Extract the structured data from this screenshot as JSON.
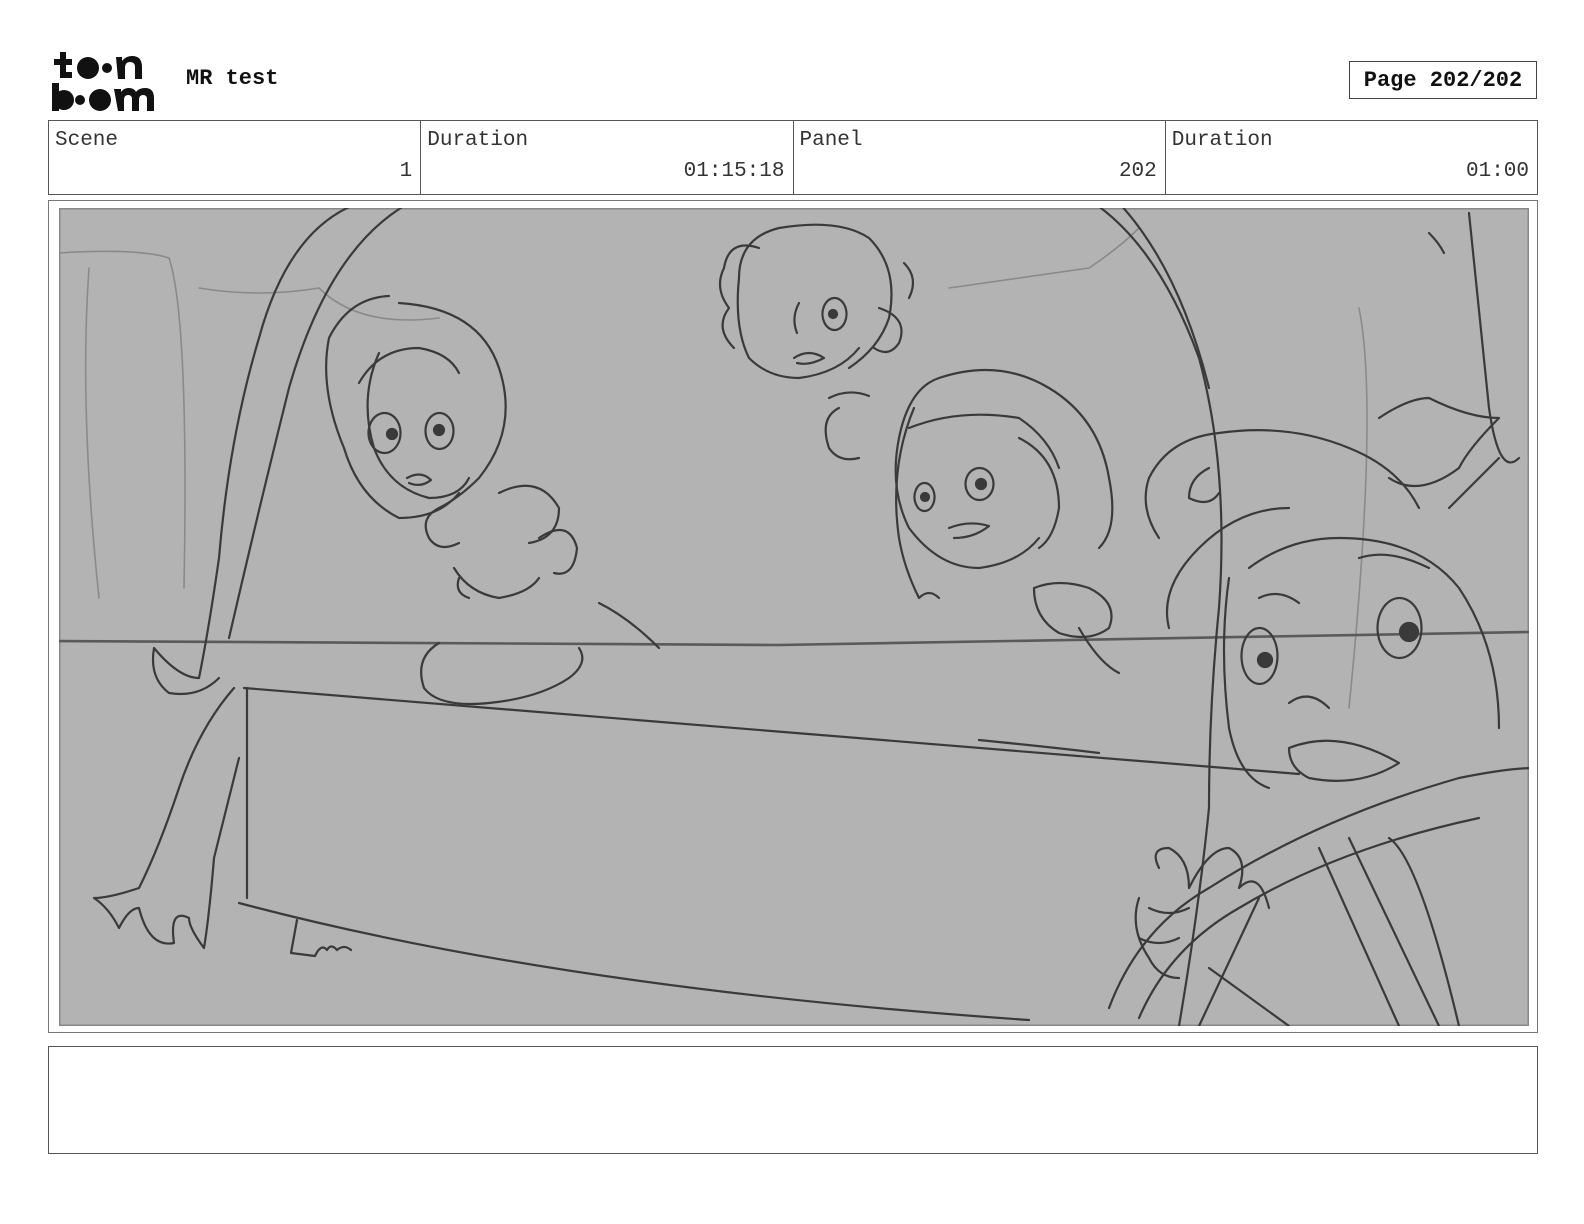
{
  "header": {
    "logo_text": "toon boom",
    "project_title": "MR test",
    "page_label": "Page 202/202"
  },
  "info": {
    "scene_label": "Scene",
    "scene_value": "1",
    "scene_duration_label": "Duration",
    "scene_duration_value": "01:15:18",
    "panel_label": "Panel",
    "panel_value": "202",
    "panel_duration_label": "Duration",
    "panel_duration_value": "01:00"
  },
  "notes": {
    "text": ""
  },
  "colors": {
    "panel_background": "#b3b3b3",
    "sketch_line": "#3a3a3a"
  }
}
